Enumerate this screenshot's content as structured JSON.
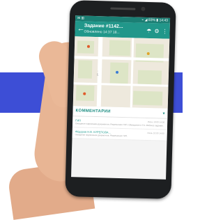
{
  "status_bar": {
    "left_icons": "✉ ⊞",
    "right_text": "⌁ ◢ 83% ▮ 14:43"
  },
  "app_bar": {
    "title": "Задание #1142...",
    "subtitle": "Обновлено 14:37 18...",
    "back_icon": "←",
    "icon_umbrella": "☂",
    "icon_settings": "⚙",
    "icon_more": "⋮"
  },
  "map": {
    "road_label": "ул. ...",
    "pin_colors": [
      "#e05a2a",
      "#3a7bd5",
      "#e0a52a"
    ]
  },
  "comments_section": {
    "header": "КОММЕНТАРИИ",
    "toggle_icon": "▾",
    "items": [
      {
        "author": "ГИП",
        "time": "Июнь 18:00 14:00",
        "text": "Ожидание подписания документов. Разрешение ГИП. Обращение в ТО. Рабочее задание."
      },
      {
        "author": "Фёдоров Н.В. КУРЕПОВА...",
        "time": "Июнь 18:00 14:00",
        "text": "Ожидание подписания документов. Разрешение ГИП."
      }
    ]
  },
  "colors": {
    "accent": "#21978a",
    "band": "#3d4ed6"
  }
}
